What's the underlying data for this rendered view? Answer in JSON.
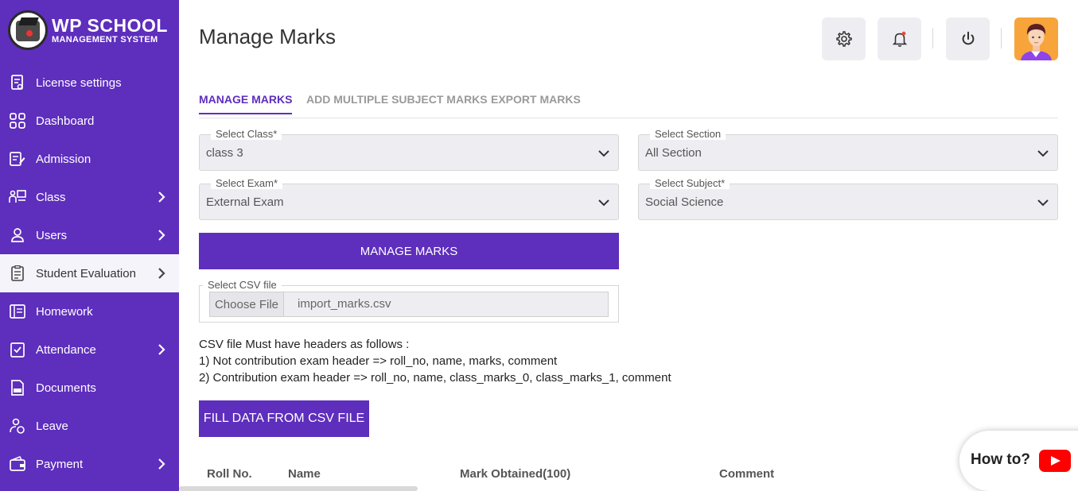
{
  "brand": {
    "line1": "WP SCHOOL",
    "line2": "MANAGEMENT SYSTEM"
  },
  "sidebar": {
    "items": [
      {
        "label": "License settings",
        "icon": "license-icon",
        "chevron": false
      },
      {
        "label": "Dashboard",
        "icon": "dashboard-icon",
        "chevron": false
      },
      {
        "label": "Admission",
        "icon": "admission-icon",
        "chevron": false
      },
      {
        "label": "Class",
        "icon": "class-icon",
        "chevron": true
      },
      {
        "label": "Users",
        "icon": "user-icon",
        "chevron": true
      },
      {
        "label": "Student Evaluation",
        "icon": "evaluation-icon",
        "chevron": true,
        "active": true
      },
      {
        "label": "Homework",
        "icon": "homework-icon",
        "chevron": false
      },
      {
        "label": "Attendance",
        "icon": "attendance-icon",
        "chevron": true
      },
      {
        "label": "Documents",
        "icon": "documents-icon",
        "chevron": false
      },
      {
        "label": "Leave",
        "icon": "leave-icon",
        "chevron": false
      },
      {
        "label": "Payment",
        "icon": "payment-icon",
        "chevron": true
      }
    ]
  },
  "header": {
    "title": "Manage Marks",
    "icons": [
      "gear-icon",
      "bell-icon",
      "power-icon",
      "avatar"
    ]
  },
  "tabs": [
    {
      "label": "MANAGE MARKS",
      "active": true
    },
    {
      "label": "ADD MULTIPLE SUBJECT MARKS",
      "active": false
    },
    {
      "label": "EXPORT MARKS",
      "active": false
    }
  ],
  "form": {
    "class": {
      "label": "Select Class*",
      "value": "class 3"
    },
    "section": {
      "label": "Select Section",
      "value": "All Section"
    },
    "exam": {
      "label": "Select Exam*",
      "value": "External Exam"
    },
    "subject": {
      "label": "Select Subject*",
      "value": "Social Science"
    },
    "submit_label": "MANAGE MARKS",
    "csv": {
      "label": "Select CSV file",
      "button": "Choose File",
      "filename": "import_marks.csv"
    },
    "info": {
      "line1": "CSV file Must have headers as follows :",
      "line2": "1) Not contribution exam header => roll_no, name, marks, comment",
      "line3": "2) Contribution exam header => roll_no, name, class_marks_0, class_marks_1, comment"
    },
    "fill_label": "FILL DATA FROM CSV FILE"
  },
  "table": {
    "columns": [
      "Roll No.",
      "Name",
      "Mark Obtained(100)",
      "Comment"
    ]
  },
  "help": {
    "label": "How to?"
  },
  "colors": {
    "brand": "#5e2ebd",
    "accent": "#5e2ebd",
    "notification": "#e74c3c"
  }
}
